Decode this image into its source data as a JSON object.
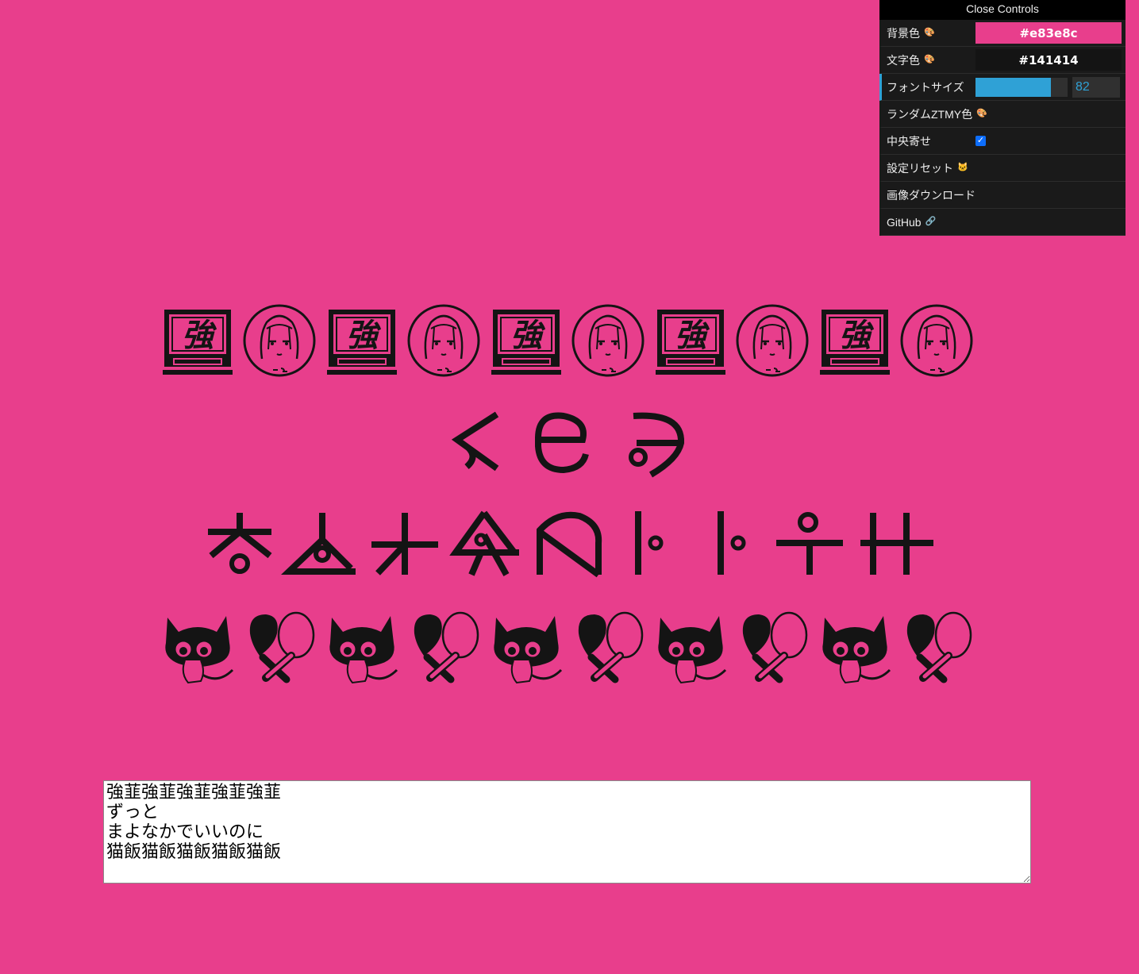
{
  "gui": {
    "close_label": "Close Controls",
    "controls": {
      "bg_color": {
        "label": "背景色",
        "icon": "palette-icon",
        "value": "#e83e8c"
      },
      "text_color": {
        "label": "文字色",
        "icon": "palette-icon",
        "value": "#141414"
      },
      "font_size": {
        "label": "フォントサイズ",
        "value": "82",
        "fill_fraction": 0.82
      },
      "random_color": {
        "label": "ランダムZTMY色",
        "icon": "palette-icon"
      },
      "center_align": {
        "label": "中央寄せ",
        "checked": true
      },
      "reset": {
        "label": "設定リセット",
        "icon": "cat-face-icon"
      },
      "download": {
        "label": "画像ダウンロード"
      },
      "github": {
        "label": "GitHub",
        "icon": "link-icon"
      }
    }
  },
  "editor": {
    "text": "強韮強韮強韮強韮強韮\nずっと\nまよなかでいいのに\n猫飯猫飯猫飯猫飯猫飯"
  },
  "colors": {
    "background": "#e83e8c",
    "text": "#141414",
    "accent": "#2fa1d6"
  }
}
